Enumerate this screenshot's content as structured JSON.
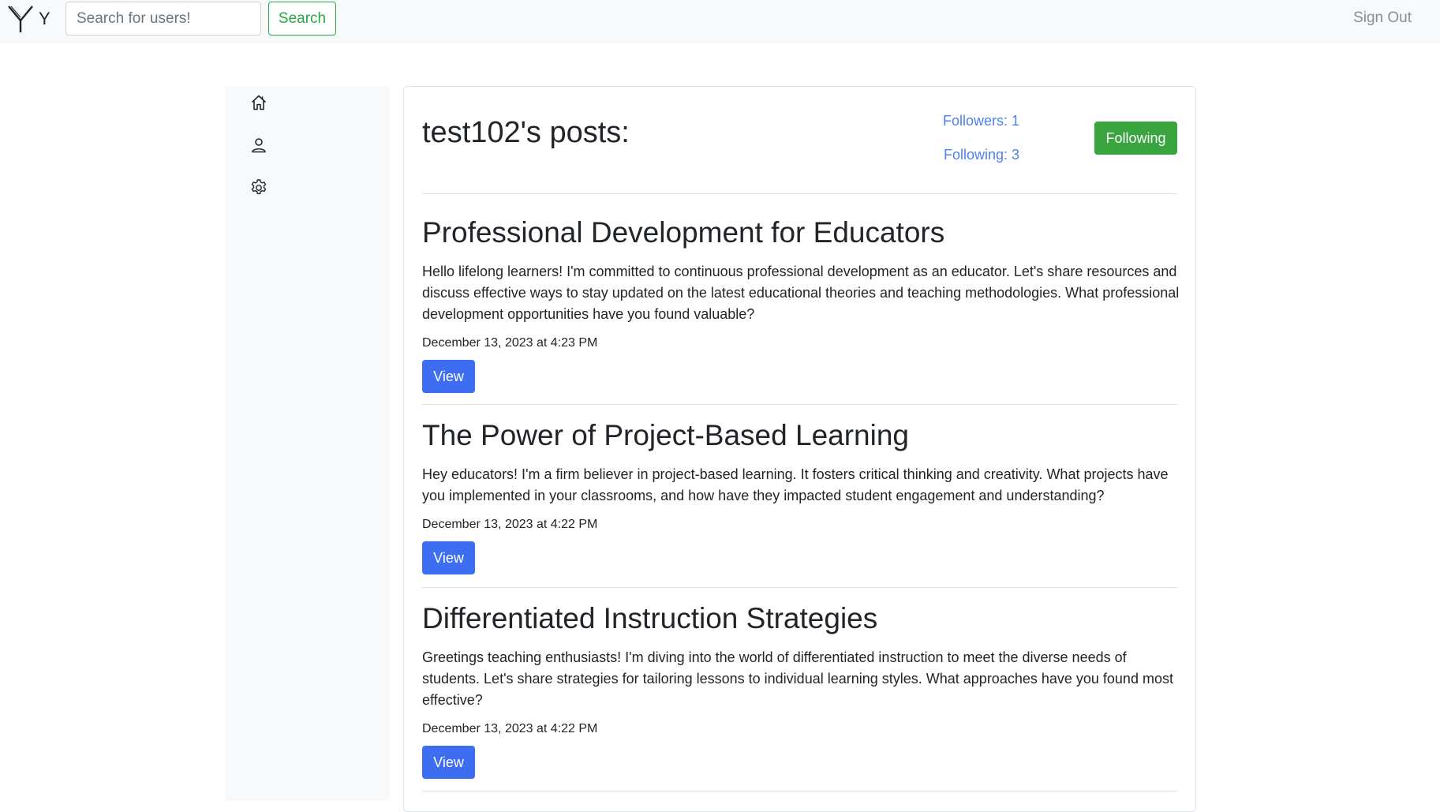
{
  "navbar": {
    "brand_text": "Y",
    "search_placeholder": "Search for users!",
    "search_value": "",
    "search_button_label": "Search",
    "signout_label": "Sign Out"
  },
  "sidebar": {
    "items": [
      {
        "icon": "home-icon"
      },
      {
        "icon": "person-icon"
      },
      {
        "icon": "gear-icon"
      }
    ]
  },
  "profile": {
    "title": "test102's posts:",
    "followers_label": "Followers: 1",
    "following_label": "Following: 3",
    "follow_button_label": "Following"
  },
  "posts": [
    {
      "title": "Professional Development for Educators",
      "body": "Hello lifelong learners! I'm committed to continuous professional development as an educator. Let's share resources and discuss effective ways to stay updated on the latest educational theories and teaching methodologies. What professional development opportunities have you found valuable?",
      "date": "December 13, 2023 at 4:23 PM",
      "view_label": "View"
    },
    {
      "title": "The Power of Project-Based Learning",
      "body": "Hey educators! I'm a firm believer in project-based learning. It fosters critical thinking and creativity. What projects have you implemented in your classrooms, and how have they impacted student engagement and understanding?",
      "date": "December 13, 2023 at 4:22 PM",
      "view_label": "View"
    },
    {
      "title": "Differentiated Instruction Strategies",
      "body": "Greetings teaching enthusiasts! I'm diving into the world of differentiated instruction to meet the diverse needs of students. Let's share strategies for tailoring lessons to individual learning styles. What approaches have you found most effective?",
      "date": "December 13, 2023 at 4:22 PM",
      "view_label": "View"
    }
  ],
  "colors": {
    "navbar_bg": "#f8f9fa",
    "search_green": "#28a745",
    "following_green": "#3aa43e",
    "link_blue": "#4f7ff0",
    "view_blue": "#3d6ef2"
  }
}
